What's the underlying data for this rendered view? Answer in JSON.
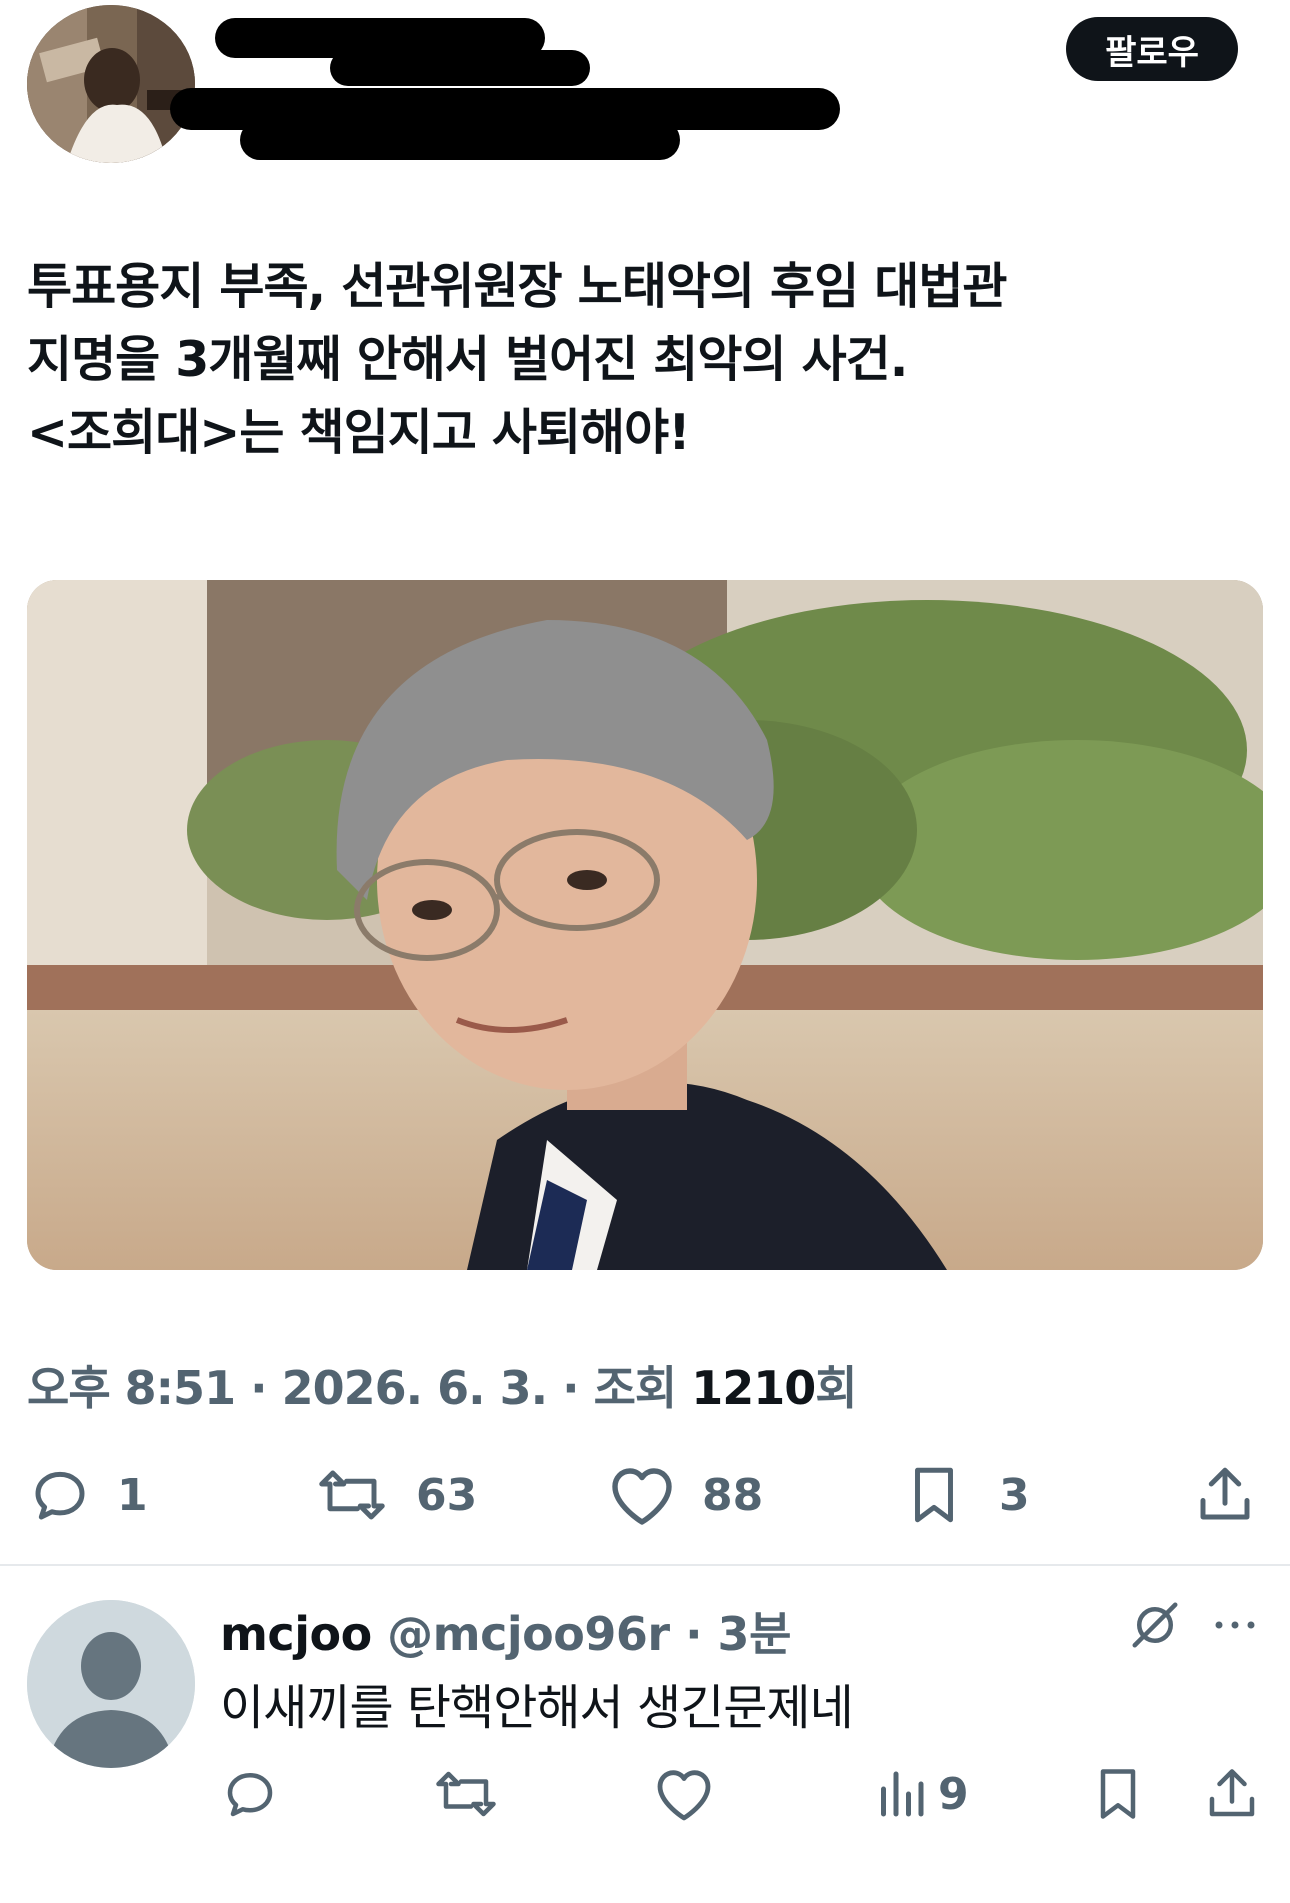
{
  "header": {
    "follow_label": "팔로우"
  },
  "tweet": {
    "text": "투표용지 부족, 선관위원장 노태악의 후임 대법관\n지명을 3개월째 안해서 벌어진 최악의 사건.\n<조희대>는 책임지고 사퇴해야!",
    "meta_time": "오후 8:51 · 2026. 6. 3. · 조회 ",
    "meta_views": "1210",
    "meta_views_suffix": "회",
    "actions": {
      "replies": "1",
      "retweets": "63",
      "likes": "88",
      "bookmarks": "3"
    }
  },
  "reply": {
    "name": "mcjoo",
    "handle_time": " @mcjoo96r · 3분",
    "text": "이새끼를 탄핵안해서 생긴문제네",
    "views": "9"
  },
  "colors": {
    "text": "#0f1419",
    "secondary": "#536471",
    "follow_bg": "#0f1419"
  }
}
